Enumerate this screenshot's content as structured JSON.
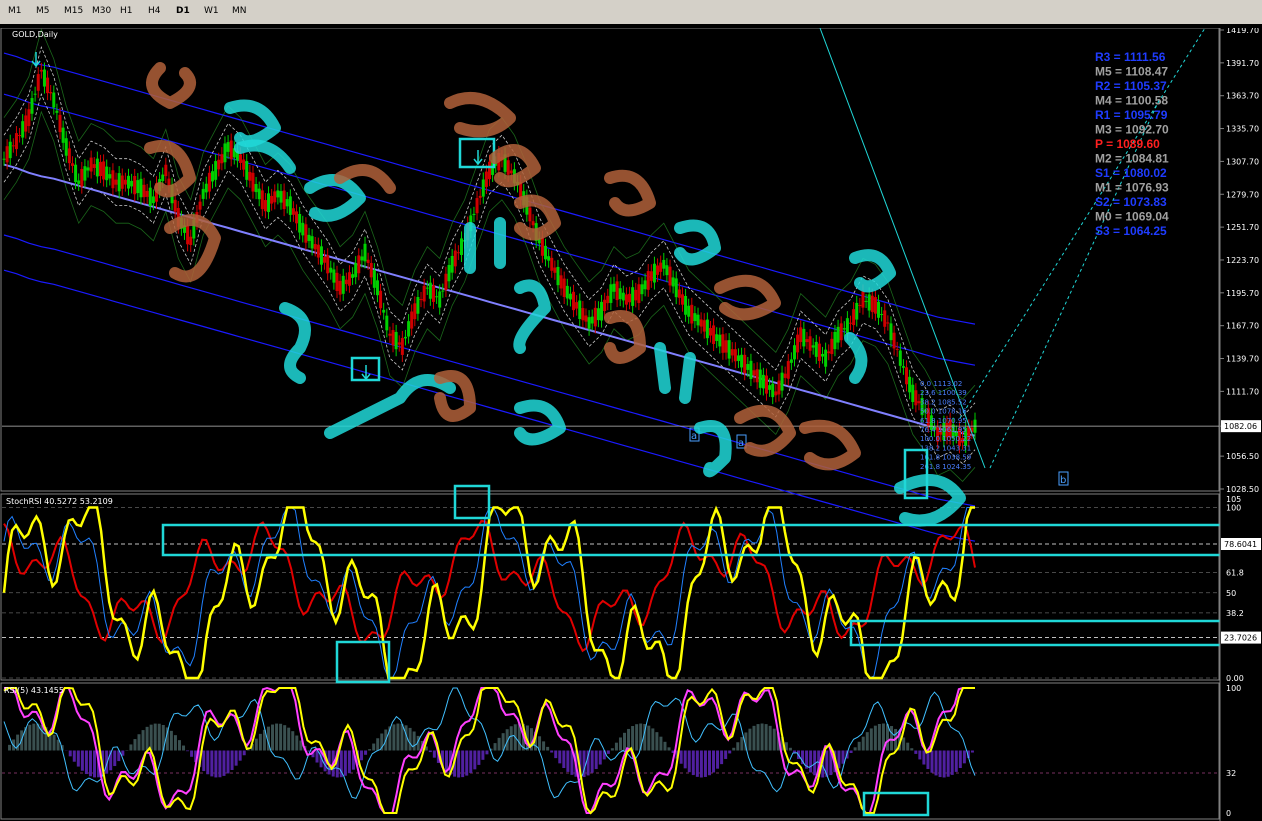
{
  "toolbar": {
    "timeframes": [
      "M1",
      "M5",
      "M15",
      "M30",
      "H1",
      "H4",
      "D1",
      "W1",
      "MN"
    ],
    "active": "D1"
  },
  "main_pane": {
    "title": "GOLD,Daily",
    "price_axis": [
      "1419.70",
      "1391.70",
      "1363.70",
      "1335.70",
      "1307.70",
      "1279.70",
      "1251.70",
      "1223.70",
      "1195.70",
      "1167.70",
      "1139.70",
      "1111.70",
      "1082.06",
      "1056.50",
      "1028.50"
    ],
    "current_price": "1082.06",
    "pivots": [
      {
        "label": "R3 = 1111.56",
        "color": "#1f3cff"
      },
      {
        "label": "M5 = 1108.47",
        "color": "#a0a0a0"
      },
      {
        "label": "R2 = 1105.37",
        "color": "#1f3cff"
      },
      {
        "label": "M4 = 1100.58",
        "color": "#a0a0a0"
      },
      {
        "label": "R1 = 1095.79",
        "color": "#1f3cff"
      },
      {
        "label": "M3 = 1092.70",
        "color": "#a0a0a0"
      },
      {
        "label": "P = 1089.60",
        "color": "#ff2020"
      },
      {
        "label": "M2 = 1084.81",
        "color": "#a0a0a0"
      },
      {
        "label": "S1 = 1080.02",
        "color": "#1f3cff"
      },
      {
        "label": "M1 = 1076.93",
        "color": "#a0a0a0"
      },
      {
        "label": "S2 = 1073.83",
        "color": "#1f3cff"
      },
      {
        "label": "M0 = 1069.04",
        "color": "#a0a0a0"
      },
      {
        "label": "S3 = 1064.25",
        "color": "#1f3cff"
      }
    ],
    "fib_levels": [
      "0.0 1113.02",
      "23.6 1100.39",
      "38.2 1085.52",
      "50.0 1078.16",
      "61.8 1070.95",
      "76.4 1061.95",
      "100.0 1050.22",
      "138.2 1043.31",
      "161.8 1038.59",
      "261.8 1024.35"
    ],
    "markers": [
      "a",
      "a",
      "b"
    ]
  },
  "stoch_pane": {
    "title": "StochRSI 40.5272 53.2109",
    "axis": [
      "105",
      "100",
      "78.6041",
      "61.8",
      "50",
      "38.2",
      "23.7026",
      "0.00"
    ],
    "hl_high": "78.6041",
    "hl_low": "23.7026"
  },
  "rsi_pane": {
    "title": "RSI(5) 43.1455",
    "axis": [
      "100",
      "32",
      "0"
    ]
  },
  "colors": {
    "pivot_resistance": "#1f3cff",
    "pivot_mid": "#a0a0a0",
    "pivot": "#ff2020",
    "stoch_main": "#ffff00",
    "stoch_signal": "#e00000",
    "rsi": "#ffff00",
    "rsi_ma": "#ff40ff",
    "annotation_cyan": "#20d8d8",
    "annotation_brown": "#b0603a"
  },
  "chart_data": {
    "type": "line",
    "title": "GOLD,Daily",
    "xlabel": "",
    "ylabel": "",
    "ylim": [
      1028.5,
      1419.7
    ],
    "series": [
      {
        "values": [
          1310,
          1325,
          1345,
          1385,
          1360,
          1320,
          1290,
          1305,
          1300,
          1290,
          1290,
          1285,
          1275,
          1300,
          1260,
          1240,
          1280,
          1300,
          1320,
          1310,
          1290,
          1270,
          1280,
          1270,
          1250,
          1235,
          1220,
          1200,
          1210,
          1230,
          1200,
          1160,
          1150,
          1180,
          1200,
          1190,
          1220,
          1240,
          1270,
          1300,
          1310,
          1295,
          1270,
          1240,
          1220,
          1200,
          1185,
          1170,
          1180,
          1200,
          1190,
          1195,
          1210,
          1220,
          1200,
          1180,
          1170,
          1160,
          1150,
          1140,
          1130,
          1120,
          1110,
          1130,
          1160,
          1150,
          1140,
          1160,
          1170,
          1190,
          1185,
          1170,
          1140,
          1110,
          1095,
          1075,
          1080,
          1070,
          1082
        ]
      },
      {
        "values": [
          1305,
          1302,
          1298,
          1295,
          1293,
          1290,
          1287,
          1284,
          1281,
          1278,
          1275,
          1272,
          1269,
          1266,
          1263,
          1260,
          1257,
          1254,
          1251,
          1248,
          1245,
          1242,
          1239,
          1236,
          1233,
          1230,
          1227,
          1224,
          1221,
          1218,
          1215,
          1212,
          1209,
          1206,
          1203,
          1200,
          1197,
          1194,
          1191,
          1188,
          1185,
          1182,
          1179,
          1176,
          1173,
          1170,
          1167,
          1164,
          1161,
          1158,
          1155,
          1152,
          1149,
          1146,
          1143,
          1140,
          1137,
          1134,
          1131,
          1128,
          1125,
          1122,
          1119,
          1116,
          1113,
          1110,
          1107,
          1104,
          1101,
          1098,
          1095,
          1092,
          1089,
          1086,
          1083,
          1080,
          1078,
          1076,
          1074
        ]
      }
    ]
  }
}
